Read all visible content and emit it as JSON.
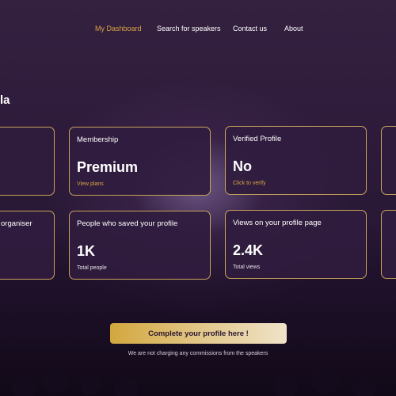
{
  "nav": {
    "items": [
      {
        "label": "My Dashboard",
        "active": true
      },
      {
        "label": "Search for speakers",
        "active": false
      },
      {
        "label": "Contact us",
        "active": false
      },
      {
        "label": "About",
        "active": false
      }
    ]
  },
  "greeting": "la",
  "cards": {
    "left_top": {
      "label": ""
    },
    "left_bottom": {
      "label": "organiser"
    },
    "membership": {
      "label": "Membership",
      "value": "Premium",
      "sub": "View plans"
    },
    "verified": {
      "label": "Verified Profile",
      "value": "No",
      "sub": "Click to verify"
    },
    "saved": {
      "label": "People who saved your profile",
      "value": "1K",
      "sub": "Total people"
    },
    "views": {
      "label": "Views on your profile page",
      "value": "2.4K",
      "sub": "Total views"
    }
  },
  "cta": {
    "button_label": "Complete your profile here !",
    "note": "We are not charging any commissions from the speakers"
  },
  "colors": {
    "accent": "#d9a441",
    "card_border": "#c9a35a",
    "card_bg": "#301c3e",
    "background": "#2e1b3c"
  }
}
